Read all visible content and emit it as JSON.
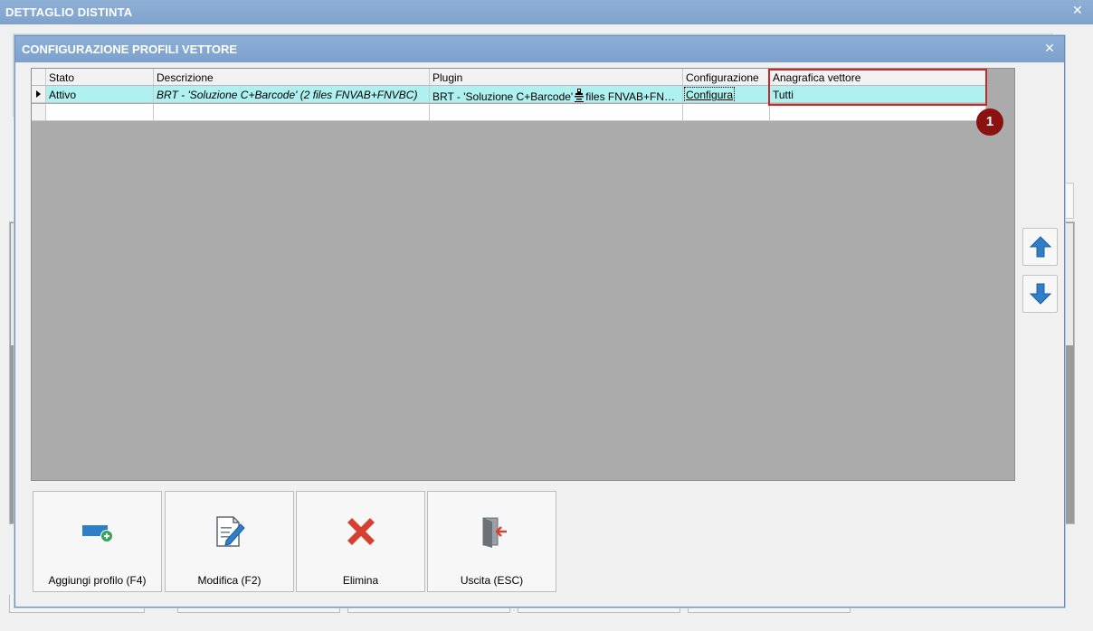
{
  "background_window": {
    "title": "DETTAGLIO DISTINTA",
    "close_icon": "close-icon"
  },
  "dialog": {
    "title": "CONFIGURAZIONE PROFILI VETTORE",
    "close_icon": "close-icon"
  },
  "grid": {
    "columns": [
      "Stato",
      "Descrizione",
      "Plugin",
      "Configurazione",
      "Anagrafica vettore"
    ],
    "rows": [
      {
        "stato": "Attivo",
        "descrizione": "BRT - 'Soluzione C+Barcode' (2 files FNVAB+FNVBC)",
        "plugin": "BRT - 'Soluzione C+Barcode'",
        "plugin_suffix": "files FNVAB+FNVBC",
        "configurazione": "Configura",
        "anagrafica": "Tutti"
      }
    ]
  },
  "annotation": {
    "badge": "1",
    "color": "#c62b2b"
  },
  "side_buttons": {
    "up_icon": "arrow-up-icon",
    "down_icon": "arrow-down-icon"
  },
  "toolbar": {
    "add_label": "Aggiungi profilo (F4)",
    "edit_label": "Modifica (F2)",
    "delete_label": "Elimina",
    "exit_label": "Uscita (ESC)"
  },
  "colors": {
    "titlebar": "#7fa2cc",
    "selected_row": "#aff0f0",
    "grid_background": "#ababab",
    "icon_blue": "#2f7fc8",
    "delete_red": "#d64030"
  }
}
